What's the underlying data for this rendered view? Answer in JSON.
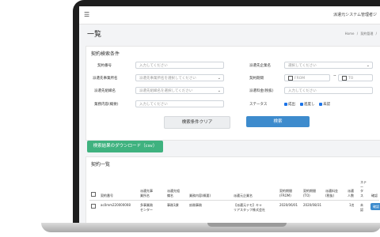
{
  "header": {
    "menu_icon": "hamburger-icon",
    "system_name": "派遣元システム管理者ジ"
  },
  "page": {
    "title": "一覧",
    "breadcrumb": [
      "Home",
      "/",
      "契約管理",
      "/"
    ]
  },
  "search": {
    "title": "契約検索条件",
    "contract_no": {
      "label": "契約番号",
      "placeholder": "入力してください"
    },
    "client_company": {
      "label": "派遣先企業名",
      "placeholder": "選択してください"
    },
    "client_office": {
      "label": "派遣先事業所名",
      "placeholder": "派遣先事業所名を選択してください"
    },
    "period": {
      "label": "契約期間",
      "from": "FROM",
      "tilde": "~",
      "to": "TO"
    },
    "client_org": {
      "label": "派遣先組織名",
      "placeholder": "派遣先組織名を選択してください"
    },
    "amount": {
      "label": "派遣料金(税抜)",
      "placeholder": "入力してください"
    },
    "work": {
      "label": "業務内容(概要)",
      "placeholder": "入力してください"
    },
    "status": {
      "label": "ステータス",
      "options": [
        "成出",
        "進度し",
        "未認"
      ]
    },
    "clear_button": "検索条件クリア",
    "search_button": "検索"
  },
  "csv_button": "検索結果のダウンロード（csv）",
  "list": {
    "title": "契約一覧",
    "headers": {
      "contract_no": "契約番号",
      "client_company": [
        "派遣先事",
        "業所名"
      ],
      "org": [
        "派遣先組",
        "織名"
      ],
      "work": "業務内容(概要)",
      "vendor": "派遣元企業名",
      "period_from": [
        "契約期間",
        "(FROM)"
      ],
      "period_to": [
        "契約期間",
        "(TO)"
      ],
      "amount": [
        "派遣料金",
        "(税抜)"
      ],
      "count": [
        "派遣",
        "人数"
      ],
      "status": [
        "ステ",
        "ー",
        "タ",
        "ス"
      ],
      "confirm": "確認"
    },
    "rows": [
      {
        "contract_no": "ac0mm220000008",
        "client_company": [
          "多事業務",
          "センター"
        ],
        "org": "事務1課",
        "work": "庶務事務",
        "vendor": [
          "【派遣元テモ】キャ",
          "リアスタッフ株式会社"
        ],
        "period_from": "2020/06/01",
        "period_to": "2020/08/31",
        "amount": "",
        "count": "1名",
        "status": [
          "未",
          "認"
        ],
        "confirm": "確認"
      }
    ]
  },
  "colors": {
    "primary": "#3d8bcd",
    "success": "#3fb27f",
    "checkbox": "#1a73e8"
  }
}
